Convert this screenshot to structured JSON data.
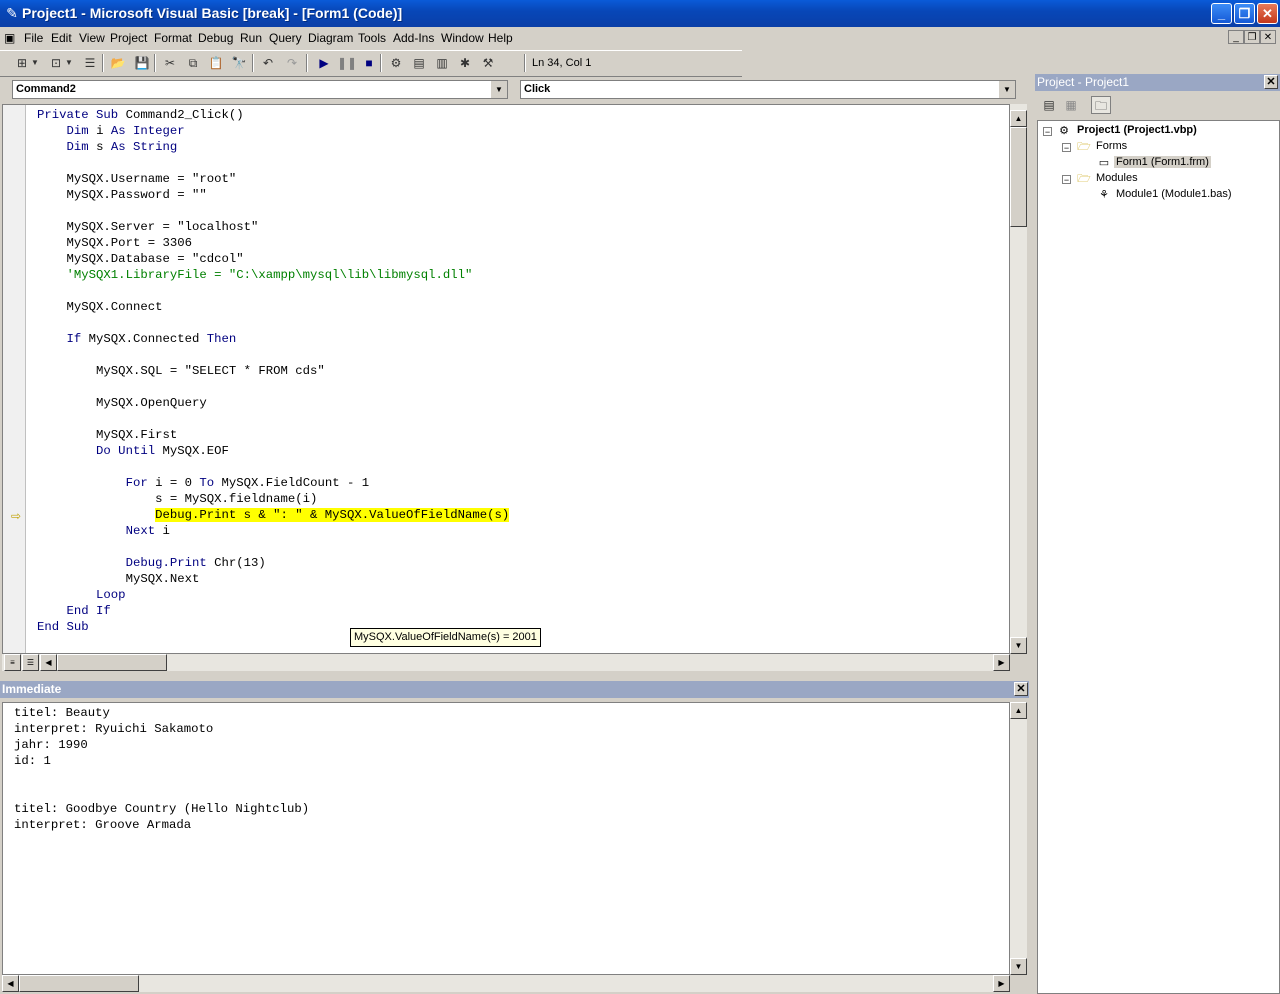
{
  "window": {
    "title": "Project1 - Microsoft Visual Basic [break] - [Form1 (Code)]"
  },
  "menu": [
    "File",
    "Edit",
    "View",
    "Project",
    "Format",
    "Debug",
    "Run",
    "Query",
    "Diagram",
    "Tools",
    "Add-Ins",
    "Window",
    "Help"
  ],
  "toolbar": {
    "cursor_position": "Ln 34, Col 1"
  },
  "code_window": {
    "object_combo": "Command2",
    "procedure_combo": "Click",
    "lines": [
      {
        "indent": 0,
        "parts": [
          {
            "t": "Private Sub ",
            "k": "kw"
          },
          {
            "t": "Command2_Click()",
            "k": ""
          }
        ]
      },
      {
        "indent": 1,
        "parts": [
          {
            "t": "Dim ",
            "k": "kw"
          },
          {
            "t": "i ",
            "k": ""
          },
          {
            "t": "As Integer",
            "k": "kw"
          }
        ]
      },
      {
        "indent": 1,
        "parts": [
          {
            "t": "Dim ",
            "k": "kw"
          },
          {
            "t": "s ",
            "k": ""
          },
          {
            "t": "As String",
            "k": "kw"
          }
        ]
      },
      {
        "indent": 0,
        "parts": []
      },
      {
        "indent": 1,
        "parts": [
          {
            "t": "MySQX.Username = \"root\"",
            "k": ""
          }
        ]
      },
      {
        "indent": 1,
        "parts": [
          {
            "t": "MySQX.Password = \"\"",
            "k": ""
          }
        ]
      },
      {
        "indent": 0,
        "parts": []
      },
      {
        "indent": 1,
        "parts": [
          {
            "t": "MySQX.Server = \"localhost\"",
            "k": ""
          }
        ]
      },
      {
        "indent": 1,
        "parts": [
          {
            "t": "MySQX.Port = 3306",
            "k": ""
          }
        ]
      },
      {
        "indent": 1,
        "parts": [
          {
            "t": "MySQX.Database = \"cdcol\"",
            "k": ""
          }
        ]
      },
      {
        "indent": 1,
        "parts": [
          {
            "t": "'MySQX1.LibraryFile = \"C:\\xampp\\mysql\\lib\\libmysql.dll\"",
            "k": "cm"
          }
        ]
      },
      {
        "indent": 0,
        "parts": []
      },
      {
        "indent": 1,
        "parts": [
          {
            "t": "MySQX.Connect",
            "k": ""
          }
        ]
      },
      {
        "indent": 0,
        "parts": []
      },
      {
        "indent": 1,
        "parts": [
          {
            "t": "If ",
            "k": "kw"
          },
          {
            "t": "MySQX.Connected ",
            "k": ""
          },
          {
            "t": "Then",
            "k": "kw"
          }
        ]
      },
      {
        "indent": 0,
        "parts": []
      },
      {
        "indent": 2,
        "parts": [
          {
            "t": "MySQX.SQL = \"SELECT * FROM cds\"",
            "k": ""
          }
        ]
      },
      {
        "indent": 0,
        "parts": []
      },
      {
        "indent": 2,
        "parts": [
          {
            "t": "MySQX.OpenQuery",
            "k": ""
          }
        ]
      },
      {
        "indent": 0,
        "parts": []
      },
      {
        "indent": 2,
        "parts": [
          {
            "t": "MySQX.First",
            "k": ""
          }
        ]
      },
      {
        "indent": 2,
        "parts": [
          {
            "t": "Do Until ",
            "k": "kw"
          },
          {
            "t": "MySQX.EOF",
            "k": ""
          }
        ]
      },
      {
        "indent": 0,
        "parts": []
      },
      {
        "indent": 3,
        "parts": [
          {
            "t": "For ",
            "k": "kw"
          },
          {
            "t": "i = 0 ",
            "k": ""
          },
          {
            "t": "To ",
            "k": "kw"
          },
          {
            "t": "MySQX.FieldCount - 1",
            "k": ""
          }
        ]
      },
      {
        "indent": 4,
        "parts": [
          {
            "t": "s = MySQX.fieldname(i)",
            "k": ""
          }
        ]
      },
      {
        "indent": 4,
        "parts": [
          {
            "t": "Debug.Print s & \": \" & MySQX.ValueOfFieldName(s)",
            "k": "hl"
          }
        ]
      },
      {
        "indent": 3,
        "parts": [
          {
            "t": "Next ",
            "k": "kw"
          },
          {
            "t": "i",
            "k": ""
          }
        ]
      },
      {
        "indent": 0,
        "parts": []
      },
      {
        "indent": 3,
        "parts": [
          {
            "t": "Debug.Print ",
            "k": "kw"
          },
          {
            "t": "Chr(13)",
            "k": ""
          }
        ]
      },
      {
        "indent": 3,
        "parts": [
          {
            "t": "MySQX.Next",
            "k": ""
          }
        ]
      },
      {
        "indent": 2,
        "parts": [
          {
            "t": "Loop",
            "k": "kw"
          }
        ]
      },
      {
        "indent": 1,
        "parts": [
          {
            "t": "End If",
            "k": "kw"
          }
        ]
      },
      {
        "indent": 0,
        "parts": [
          {
            "t": "End Sub",
            "k": "kw"
          }
        ]
      }
    ],
    "tooltip": "MySQX.ValueOfFieldName(s) = 2001"
  },
  "immediate": {
    "title": "Immediate",
    "lines": [
      "titel: Beauty",
      "interpret: Ryuichi Sakamoto",
      "jahr: 1990",
      "id: 1",
      "",
      "",
      "titel: Goodbye Country (Hello Nightclub)",
      "interpret: Groove Armada"
    ]
  },
  "project": {
    "title": "Project - Project1",
    "root": "Project1 (Project1.vbp)",
    "forms_folder": "Forms",
    "form_item": "Form1 (Form1.frm)",
    "modules_folder": "Modules",
    "module_item": "Module1 (Module1.bas)"
  }
}
